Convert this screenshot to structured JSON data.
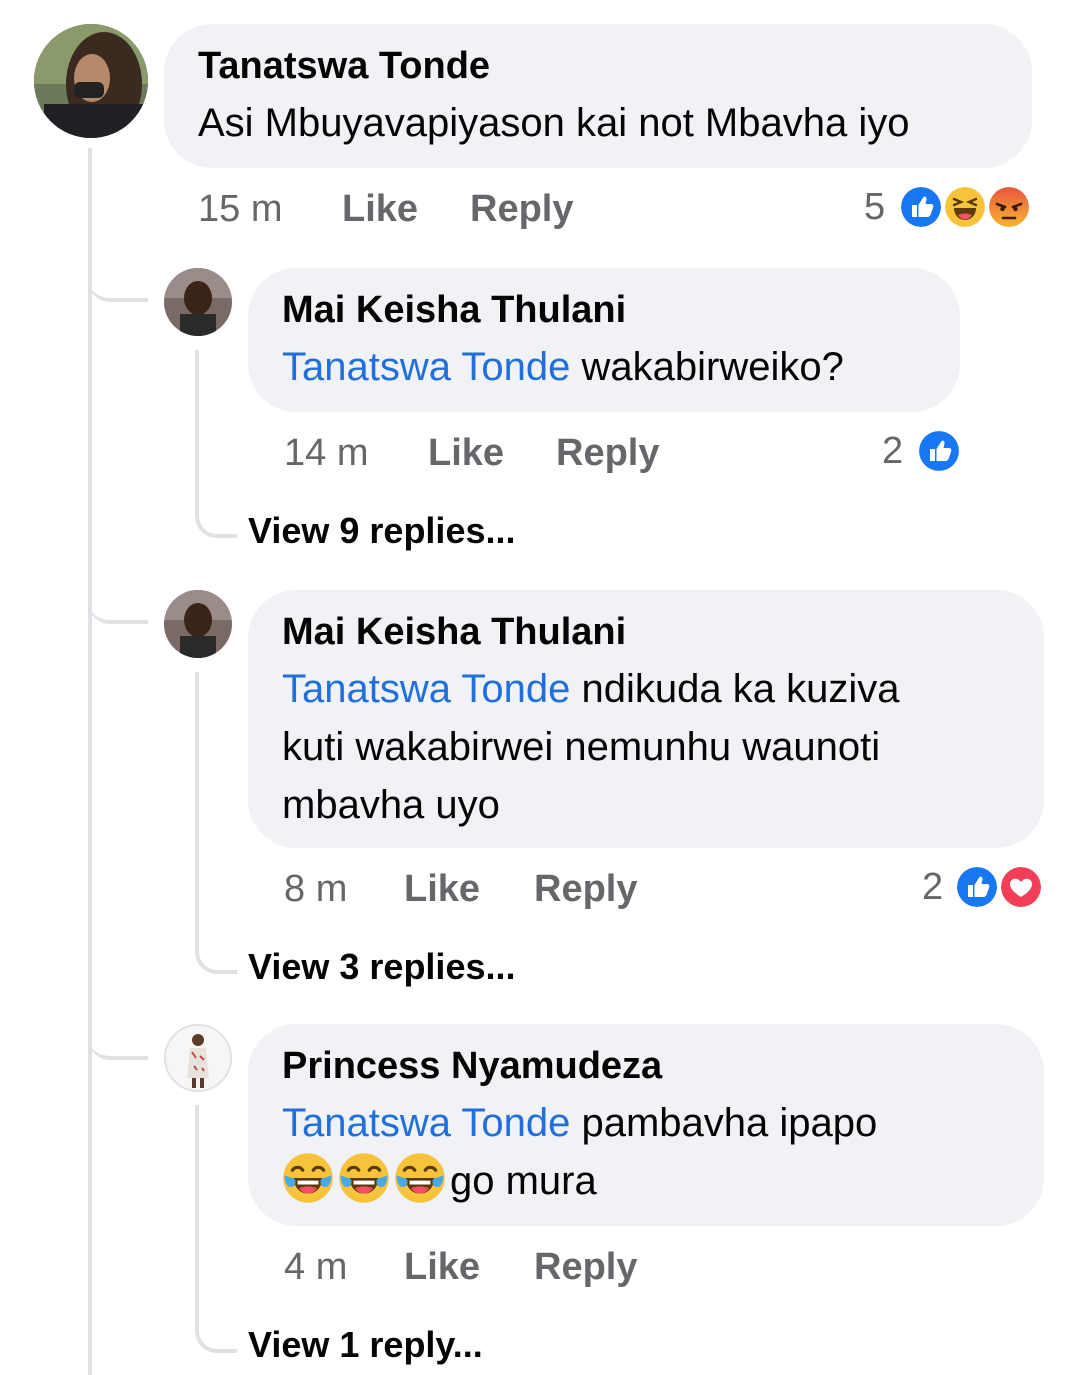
{
  "main_comment": {
    "author": "Tanatswa Tonde",
    "text": "Asi Mbuyavapiyason kai not Mbavha iyo",
    "time": "15 m",
    "like_label": "Like",
    "reply_label": "Reply",
    "reaction_count": "5",
    "reactions": [
      "like-icon",
      "haha-icon",
      "angry-icon"
    ]
  },
  "replies": [
    {
      "author": "Mai Keisha Thulani",
      "mention": "Tanatswa Tonde",
      "text": "wakabirweiko?",
      "time": "14 m",
      "like_label": "Like",
      "reply_label": "Reply",
      "reaction_count": "2",
      "reactions": [
        "like-icon"
      ],
      "view_replies": "View 9 replies..."
    },
    {
      "author": "Mai Keisha Thulani",
      "mention": "Tanatswa Tonde",
      "text_line1": "ndikuda ka kuziva",
      "text_line2": "kuti wakabirwei nemunhu waunoti",
      "text_line3": "mbavha uyo",
      "time": "8 m",
      "like_label": "Like",
      "reply_label": "Reply",
      "reaction_count": "2",
      "reactions": [
        "like-icon",
        "love-icon"
      ],
      "view_replies": "View 3 replies..."
    },
    {
      "author": "Princess Nyamudeza",
      "mention": "Tanatswa Tonde",
      "text_line1": "pambavha ipapo",
      "emojis": [
        "laughing-crying-emoji",
        "laughing-crying-emoji",
        "laughing-crying-emoji"
      ],
      "text_line2": "go mura",
      "time": "4 m",
      "like_label": "Like",
      "reply_label": "Reply",
      "view_replies": "View 1 reply..."
    }
  ],
  "colors": {
    "mention": "#216fdb",
    "bubble": "#f0f2f5",
    "meta": "#65676b",
    "like": "#1877f2",
    "love": "#f33e58"
  }
}
